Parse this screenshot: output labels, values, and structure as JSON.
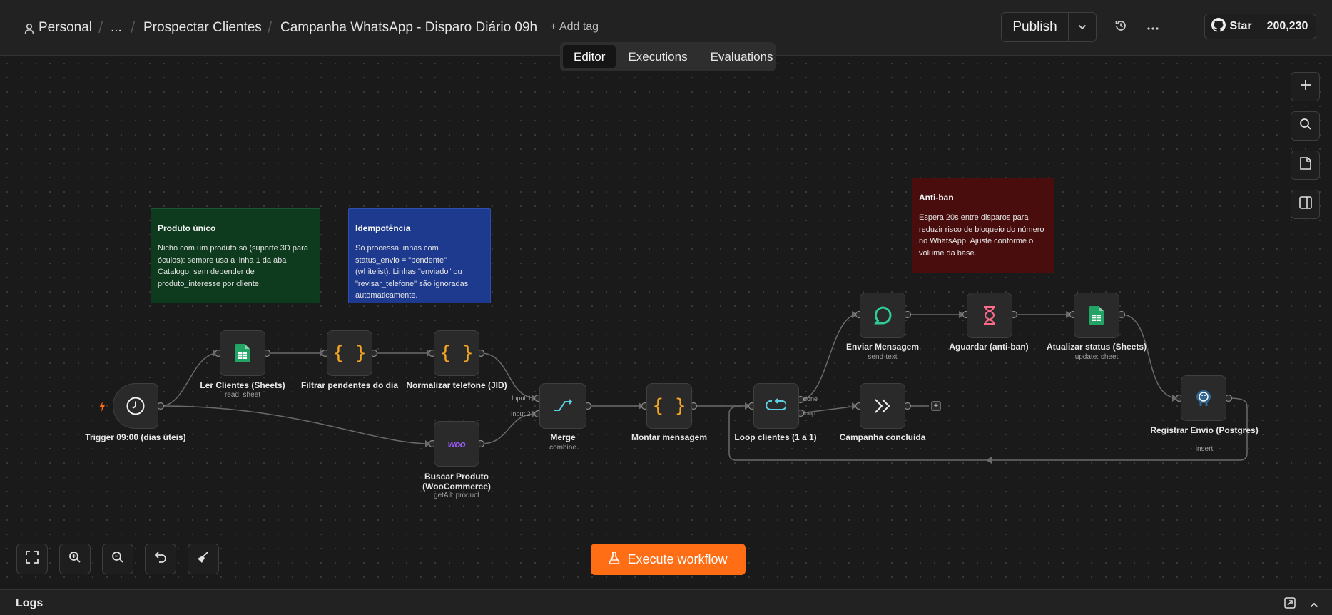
{
  "header": {
    "breadcrumb": {
      "project": "Personal",
      "ellipsis": "...",
      "folder": "Prospectar Clientes",
      "workflow_name": "Campanha WhatsApp - Disparo Diário 09h"
    },
    "add_tag": "+ Add tag",
    "publish_label": "Publish",
    "github_star_label": "Star",
    "github_star_count": "200,230"
  },
  "tabs": [
    {
      "label": "Editor",
      "active": true
    },
    {
      "label": "Executions",
      "active": false
    },
    {
      "label": "Evaluations",
      "active": false
    }
  ],
  "sticky_notes": [
    {
      "title": "Produto único",
      "body": "Nicho com um produto só (suporte 3D para óculos): sempre usa a linha 1 da aba Catalogo, sem depender de produto_interesse por cliente.",
      "color": "#0e3a1d"
    },
    {
      "title": "Idempotência",
      "body": "Só processa linhas com status_envio = \"pendente\" (whitelist). Linhas \"enviado\" ou \"revisar_telefone\" são ignoradas automaticamente.",
      "color": "#1e3a8f"
    },
    {
      "title": "Anti-ban",
      "body": "Espera 20s entre disparos para reduzir risco de bloqueio do número no WhatsApp. Ajuste conforme o volume da base.",
      "color": "#4a0d0d"
    }
  ],
  "nodes": [
    {
      "label": "Trigger 09:00 (dias úteis)",
      "subtitle": "",
      "icon": "clock-icon"
    },
    {
      "label": "Ler Clientes (Sheets)",
      "subtitle": "read: sheet",
      "icon": "google-sheets-icon"
    },
    {
      "label": "Filtrar pendentes do dia",
      "subtitle": "",
      "icon": "code-braces-icon"
    },
    {
      "label": "Normalizar telefone (JID)",
      "subtitle": "",
      "icon": "code-braces-icon"
    },
    {
      "label": "Buscar Produto (WooCommerce)",
      "subtitle": "getAll: product",
      "icon": "woocommerce-icon"
    },
    {
      "label": "Merge",
      "subtitle": "combine",
      "icon": "merge-icon"
    },
    {
      "label": "Montar mensagem",
      "subtitle": "",
      "icon": "code-braces-icon"
    },
    {
      "label": "Loop clientes (1 a 1)",
      "subtitle": "",
      "icon": "loop-icon"
    },
    {
      "label": "Campanha concluída",
      "subtitle": "",
      "icon": "no-op-icon"
    },
    {
      "label": "Enviar Mensagem",
      "subtitle": "send-text",
      "icon": "chat-bubble-icon"
    },
    {
      "label": "Aguardar (anti-ban)",
      "subtitle": "",
      "icon": "hourglass-icon"
    },
    {
      "label": "Atualizar status (Sheets)",
      "subtitle": "update: sheet",
      "icon": "google-sheets-icon"
    },
    {
      "label": "Registrar Envio (Postgres)",
      "subtitle": "insert",
      "icon": "postgres-icon"
    }
  ],
  "port_labels": {
    "merge_input_1": "Input 1",
    "merge_input_2": "Input 2",
    "loop_done": "done",
    "loop_loop": "loop"
  },
  "execute_button": "Execute workflow",
  "logs_title": "Logs",
  "colors": {
    "accent": "#ff6d14",
    "canvas": "#1a1a1a",
    "node_bg": "#2a2a2a"
  }
}
